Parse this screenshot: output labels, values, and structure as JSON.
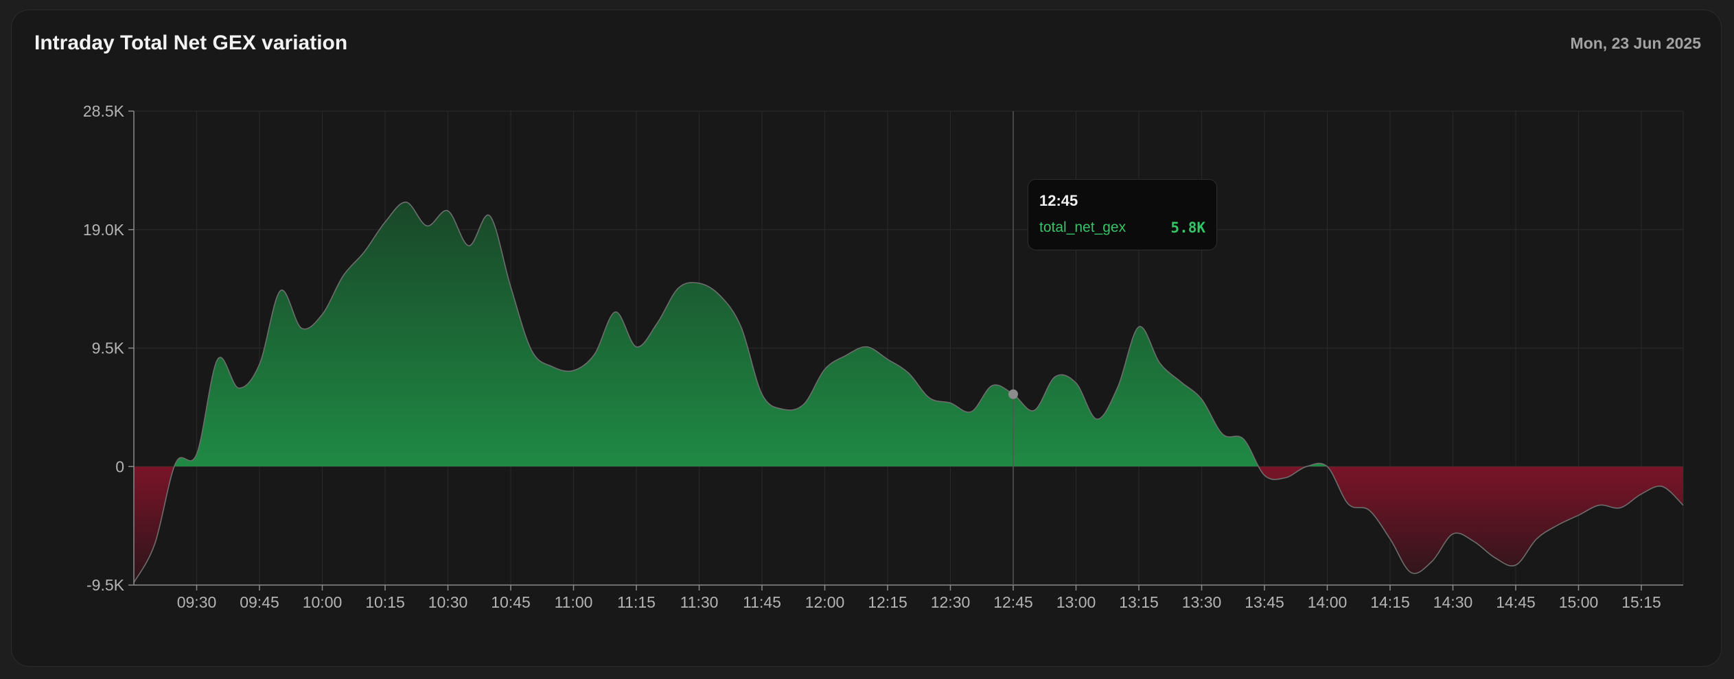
{
  "header": {
    "title": "Intraday Total Net GEX variation",
    "date": "Mon, 23 Jun 2025"
  },
  "tooltip": {
    "time": "12:45",
    "series_key": "total_net_gex",
    "value_label": "5.8K"
  },
  "colors": {
    "positive": "#1f8a44",
    "negative": "#7a1428",
    "line": "#6e6e6e",
    "grid": "#2a2a2a",
    "tooltip_text": "#35c466"
  },
  "chart_data": {
    "type": "area",
    "title": "Intraday Total Net GEX variation",
    "series": [
      {
        "name": "total_net_gex",
        "x": [
          "09:15",
          "09:20",
          "09:25",
          "09:30",
          "09:35",
          "09:40",
          "09:45",
          "09:50",
          "09:55",
          "10:00",
          "10:05",
          "10:10",
          "10:15",
          "10:20",
          "10:25",
          "10:30",
          "10:35",
          "10:40",
          "10:45",
          "10:50",
          "10:55",
          "11:00",
          "11:05",
          "11:10",
          "11:15",
          "11:20",
          "11:25",
          "11:30",
          "11:35",
          "11:40",
          "11:45",
          "11:50",
          "11:55",
          "12:00",
          "12:05",
          "12:10",
          "12:15",
          "12:20",
          "12:25",
          "12:30",
          "12:35",
          "12:40",
          "12:45",
          "12:50",
          "12:55",
          "13:00",
          "13:05",
          "13:10",
          "13:15",
          "13:20",
          "13:25",
          "13:30",
          "13:35",
          "13:40",
          "13:45",
          "13:50",
          "13:55",
          "14:00",
          "14:05",
          "14:10",
          "14:15",
          "14:20",
          "14:25",
          "14:30",
          "14:35",
          "14:40",
          "14:45",
          "14:50",
          "14:55",
          "15:00",
          "15:05",
          "15:10",
          "15:15",
          "15:20",
          "15:25"
        ],
        "values": [
          -9300,
          -6200,
          300,
          1000,
          8600,
          6300,
          8200,
          14100,
          11100,
          12200,
          15300,
          17200,
          19600,
          21200,
          19300,
          20500,
          17700,
          20100,
          14400,
          9300,
          8000,
          7700,
          9000,
          12400,
          9600,
          11500,
          14300,
          14700,
          13700,
          11200,
          5800,
          4600,
          5000,
          7800,
          8900,
          9600,
          8600,
          7500,
          5500,
          5100,
          4400,
          6500,
          5800,
          4500,
          7200,
          6700,
          3800,
          6400,
          11200,
          8300,
          6800,
          5400,
          2600,
          2200,
          -700,
          -900,
          0,
          0,
          -3000,
          -3500,
          -5800,
          -8500,
          -7600,
          -5400,
          -6000,
          -7300,
          -7900,
          -5800,
          -4700,
          -3900,
          -3100,
          -3300,
          -2200,
          -1600,
          -3100
        ]
      }
    ],
    "x_ticks": [
      "09:30",
      "09:45",
      "10:00",
      "10:15",
      "10:30",
      "10:45",
      "11:00",
      "11:15",
      "11:30",
      "11:45",
      "12:00",
      "12:15",
      "12:30",
      "12:45",
      "13:00",
      "13:15",
      "13:30",
      "13:45",
      "14:00",
      "14:15",
      "14:30",
      "14:45",
      "15:00",
      "15:15"
    ],
    "y_ticks": [
      28500,
      19000,
      9500,
      0,
      -9500
    ],
    "y_tick_labels": [
      "28.5K",
      "19.0K",
      "9.5K",
      "0",
      "-9.5K"
    ],
    "ylim": [
      -9500,
      28500
    ],
    "xlim": [
      "09:15",
      "15:25"
    ],
    "grid": true,
    "highlight": {
      "x": "12:45",
      "value": 5800
    }
  }
}
